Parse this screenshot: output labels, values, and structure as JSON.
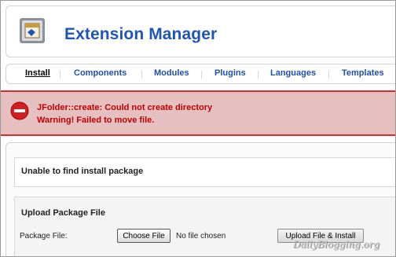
{
  "header": {
    "title": "Extension Manager",
    "logo_icon": "extension-package-icon"
  },
  "tabs": [
    {
      "label": "Install",
      "active": true
    },
    {
      "label": "Components",
      "active": false
    },
    {
      "label": "Modules",
      "active": false
    },
    {
      "label": "Plugins",
      "active": false
    },
    {
      "label": "Languages",
      "active": false
    },
    {
      "label": "Templates",
      "active": false
    }
  ],
  "error": {
    "icon": "error-minus-icon",
    "line1": "JFolder::create: Could not create directory",
    "line2": "Warning! Failed to move file."
  },
  "content": {
    "message": "Unable to find install package",
    "upload": {
      "title": "Upload Package File",
      "field_label": "Package File:",
      "choose_button": "Choose File",
      "no_file_text": "No file chosen",
      "install_button": "Upload File & Install"
    }
  },
  "watermark": "DailyBlogging.org",
  "colors": {
    "title": "#1f55b8",
    "tab_link": "#1f4fa8",
    "error_bg": "#e6c0c0",
    "error_border": "#d23030",
    "error_text": "#c00000"
  }
}
